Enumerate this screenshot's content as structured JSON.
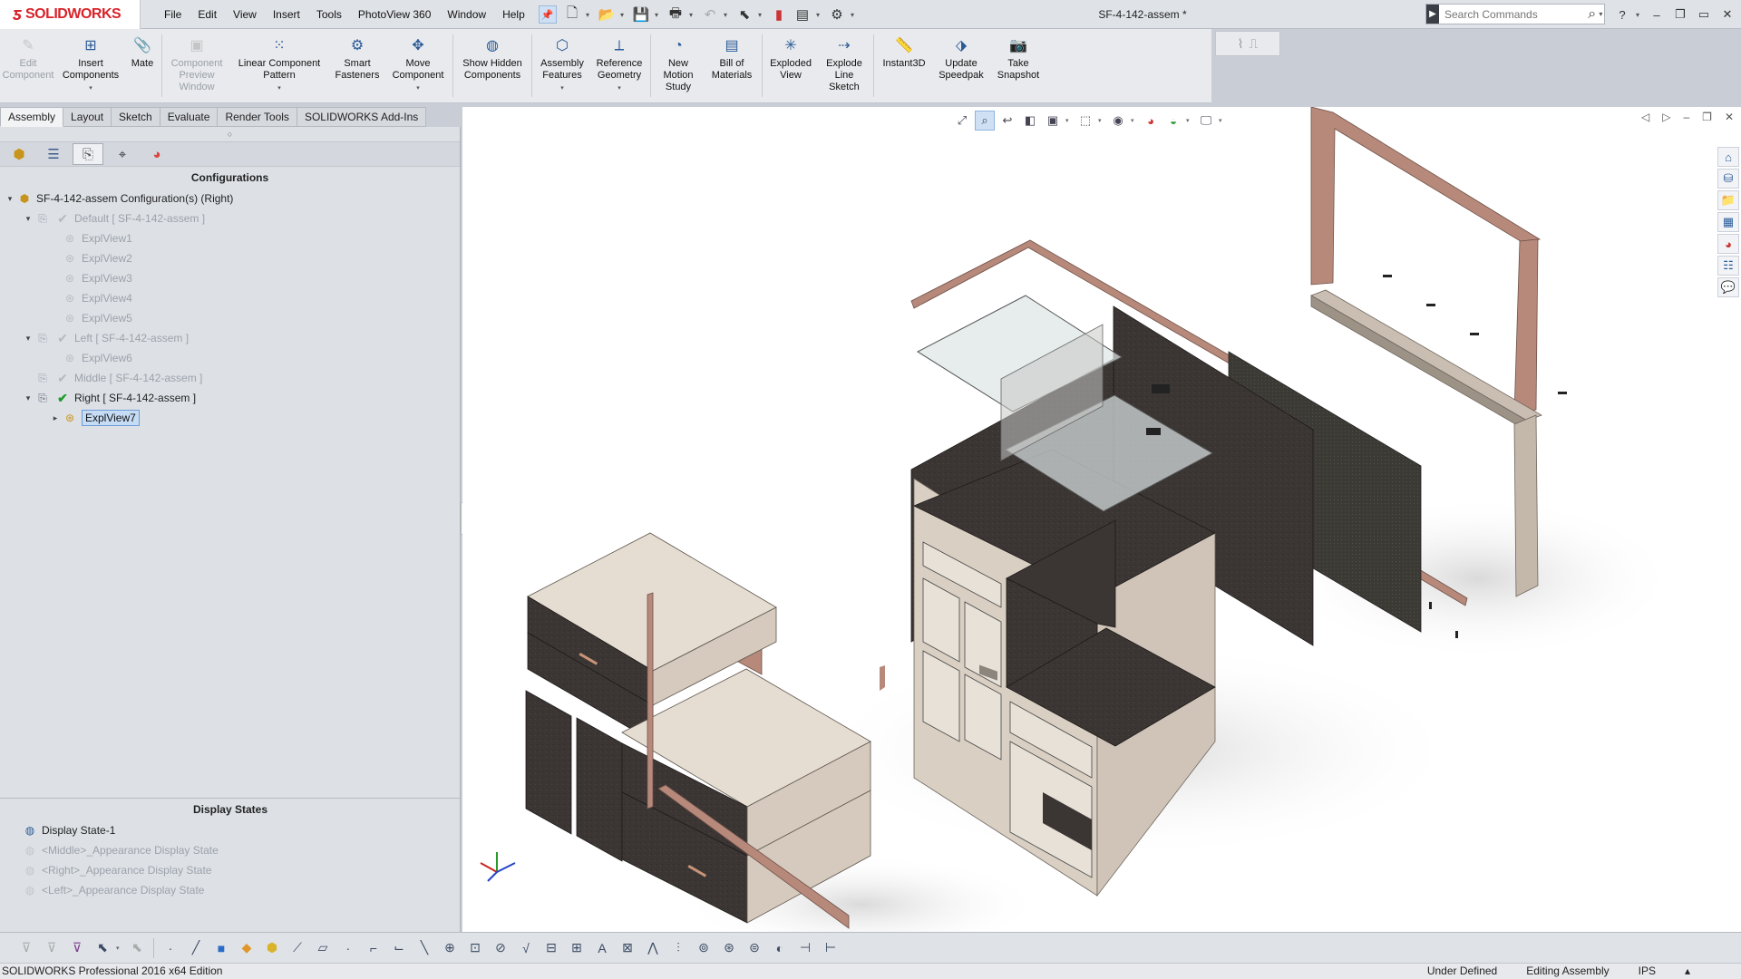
{
  "app": {
    "brand": "SOLIDWORKS",
    "document_title": "SF-4-142-assem *"
  },
  "menu": [
    "File",
    "Edit",
    "View",
    "Insert",
    "Tools",
    "PhotoView 360",
    "Window",
    "Help"
  ],
  "search": {
    "placeholder": "Search Commands"
  },
  "command_manager": [
    {
      "label": "Edit Component",
      "icon": "edit-component-icon",
      "enabled": false
    },
    {
      "label": "Insert Components",
      "icon": "insert-components-icon",
      "enabled": true
    },
    {
      "label": "Mate",
      "icon": "mate-icon",
      "enabled": true
    },
    {
      "label": "Component Preview Window",
      "icon": "component-preview-icon",
      "enabled": false
    },
    {
      "label": "Linear Component Pattern",
      "icon": "linear-pattern-icon",
      "enabled": true
    },
    {
      "label": "Smart Fasteners",
      "icon": "smart-fasteners-icon",
      "enabled": true
    },
    {
      "label": "Move Component",
      "icon": "move-component-icon",
      "enabled": true
    },
    {
      "label": "Show Hidden Components",
      "icon": "show-hidden-icon",
      "enabled": true
    },
    {
      "label": "Assembly Features",
      "icon": "assembly-features-icon",
      "enabled": true
    },
    {
      "label": "Reference Geometry",
      "icon": "reference-geometry-icon",
      "enabled": true
    },
    {
      "label": "New Motion Study",
      "icon": "motion-study-icon",
      "enabled": true
    },
    {
      "label": "Bill of Materials",
      "icon": "bom-icon",
      "enabled": true
    },
    {
      "label": "Exploded View",
      "icon": "exploded-view-icon",
      "enabled": true
    },
    {
      "label": "Explode Line Sketch",
      "icon": "explode-line-icon",
      "enabled": true
    },
    {
      "label": "Instant3D",
      "icon": "instant3d-icon",
      "enabled": true
    },
    {
      "label": "Update Speedpak",
      "icon": "speedpak-icon",
      "enabled": true
    },
    {
      "label": "Take Snapshot",
      "icon": "snapshot-icon",
      "enabled": true
    }
  ],
  "tabs": [
    {
      "label": "Assembly",
      "active": true
    },
    {
      "label": "Layout",
      "active": false
    },
    {
      "label": "Sketch",
      "active": false
    },
    {
      "label": "Evaluate",
      "active": false
    },
    {
      "label": "Render Tools",
      "active": false
    },
    {
      "label": "SOLIDWORKS Add-Ins",
      "active": false
    }
  ],
  "configurations": {
    "title": "Configurations",
    "root": "SF-4-142-assem Configuration(s)  (Right)",
    "groups": [
      {
        "label": "Default [ SF-4-142-assem ]",
        "active": false,
        "expanded": true,
        "children": [
          "ExplView1",
          "ExplView2",
          "ExplView3",
          "ExplView4",
          "ExplView5"
        ]
      },
      {
        "label": "Left [ SF-4-142-assem ]",
        "active": false,
        "expanded": true,
        "children": [
          "ExplView6"
        ]
      },
      {
        "label": "Middle [ SF-4-142-assem ]",
        "active": false,
        "expanded": false,
        "children": []
      },
      {
        "label": "Right [ SF-4-142-assem ]",
        "active": true,
        "expanded": true,
        "children": [
          "ExplView7"
        ]
      }
    ]
  },
  "display_states": {
    "title": "Display States",
    "items": [
      {
        "label": "Display State-1",
        "active": true
      },
      {
        "label": "<Middle>_Appearance Display State",
        "active": false
      },
      {
        "label": "<Right>_Appearance Display State",
        "active": false
      },
      {
        "label": "<Left>_Appearance Display State",
        "active": false
      }
    ]
  },
  "status": {
    "edition": "SOLIDWORKS Professional 2016 x64 Edition",
    "definition": "Under Defined",
    "mode": "Editing Assembly",
    "units": "IPS"
  },
  "colors": {
    "brand_red": "#d8232a",
    "wood_light": "#d9cfc3",
    "wood_dark": "#3b3634",
    "trim": "#b7897a",
    "glass": "#dde4e6"
  }
}
